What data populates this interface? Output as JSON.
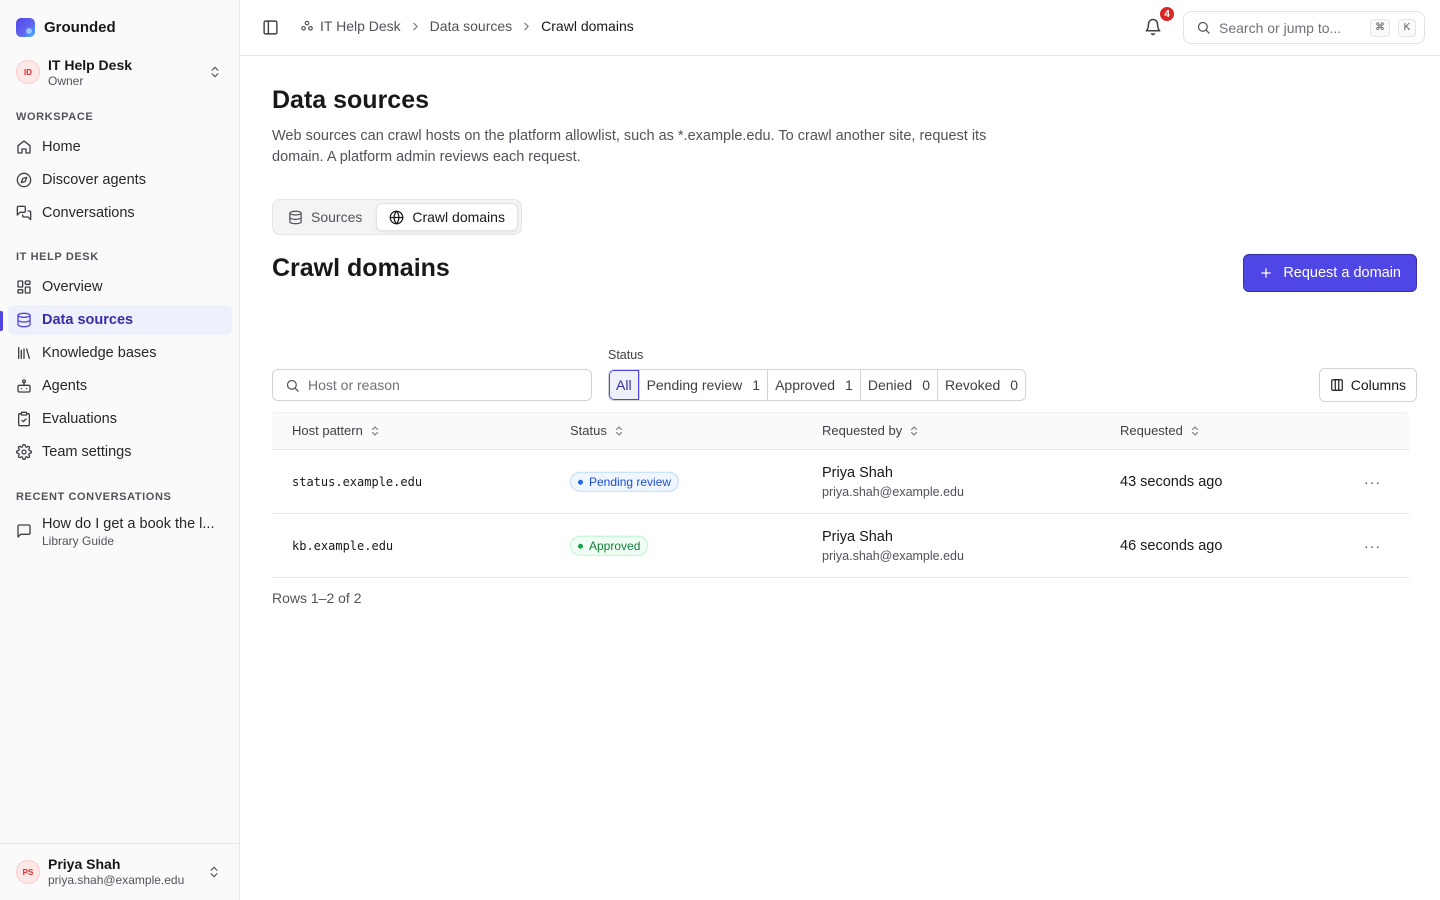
{
  "brand": {
    "name": "Grounded"
  },
  "org": {
    "initials": "ID",
    "name": "IT Help Desk",
    "role": "Owner"
  },
  "sidebar": {
    "workspace_label": "WORKSPACE",
    "workspace_items": [
      {
        "label": "Home",
        "icon": "home-icon"
      },
      {
        "label": "Discover agents",
        "icon": "compass-icon"
      },
      {
        "label": "Conversations",
        "icon": "chat-icon"
      }
    ],
    "org_label": "IT HELP DESK",
    "org_items": [
      {
        "label": "Overview",
        "icon": "grid-icon"
      },
      {
        "label": "Data sources",
        "icon": "database-icon",
        "active": true
      },
      {
        "label": "Knowledge bases",
        "icon": "library-icon"
      },
      {
        "label": "Agents",
        "icon": "bot-icon"
      },
      {
        "label": "Evaluations",
        "icon": "clipboard-check-icon"
      },
      {
        "label": "Team settings",
        "icon": "gear-icon"
      }
    ],
    "recent_label": "RECENT CONVERSATIONS",
    "recent": [
      {
        "title": "How do I get a book the l...",
        "subtitle": "Library Guide"
      }
    ]
  },
  "user": {
    "initials": "PS",
    "name": "Priya Shah",
    "email": "priya.shah@example.edu"
  },
  "topbar": {
    "breadcrumb": [
      "IT Help Desk",
      "Data sources",
      "Crawl domains"
    ],
    "notifications_count": "4",
    "search_placeholder": "Search or jump to...",
    "shortcut_keys": [
      "⌘",
      "K"
    ]
  },
  "page": {
    "title": "Data sources",
    "description": "Web sources can crawl hosts on the platform allowlist, such as *.example.edu. To crawl another site, request its domain. A platform admin reviews each request.",
    "tabs": [
      {
        "label": "Sources",
        "icon": "database-icon"
      },
      {
        "label": "Crawl domains",
        "icon": "globe-icon",
        "active": true
      }
    ],
    "section_title": "Crawl domains",
    "request_button": "Request a domain"
  },
  "filters": {
    "search_placeholder": "Host or reason",
    "status_label": "Status",
    "statuses": [
      {
        "label": "All",
        "count": "",
        "active": true
      },
      {
        "label": "Pending review",
        "count": "1"
      },
      {
        "label": "Approved",
        "count": "1"
      },
      {
        "label": "Denied",
        "count": "0"
      },
      {
        "label": "Revoked",
        "count": "0"
      }
    ],
    "columns_button": "Columns"
  },
  "table": {
    "columns": [
      "Host pattern",
      "Status",
      "Requested by",
      "Requested"
    ],
    "rows": [
      {
        "host": "status.example.edu",
        "status": "Pending review",
        "status_kind": "pending",
        "requester_name": "Priya Shah",
        "requester_email": "priya.shah@example.edu",
        "requested": "43 seconds ago"
      },
      {
        "host": "kb.example.edu",
        "status": "Approved",
        "status_kind": "approved",
        "requester_name": "Priya Shah",
        "requester_email": "priya.shah@example.edu",
        "requested": "46 seconds ago"
      }
    ],
    "row_actions": "···",
    "rows_info": "Rows 1–2 of 2"
  },
  "colors": {
    "accent": "#4f46e5",
    "danger": "#dc2626",
    "pending": "#1d4ed8",
    "approved": "#15803d"
  }
}
